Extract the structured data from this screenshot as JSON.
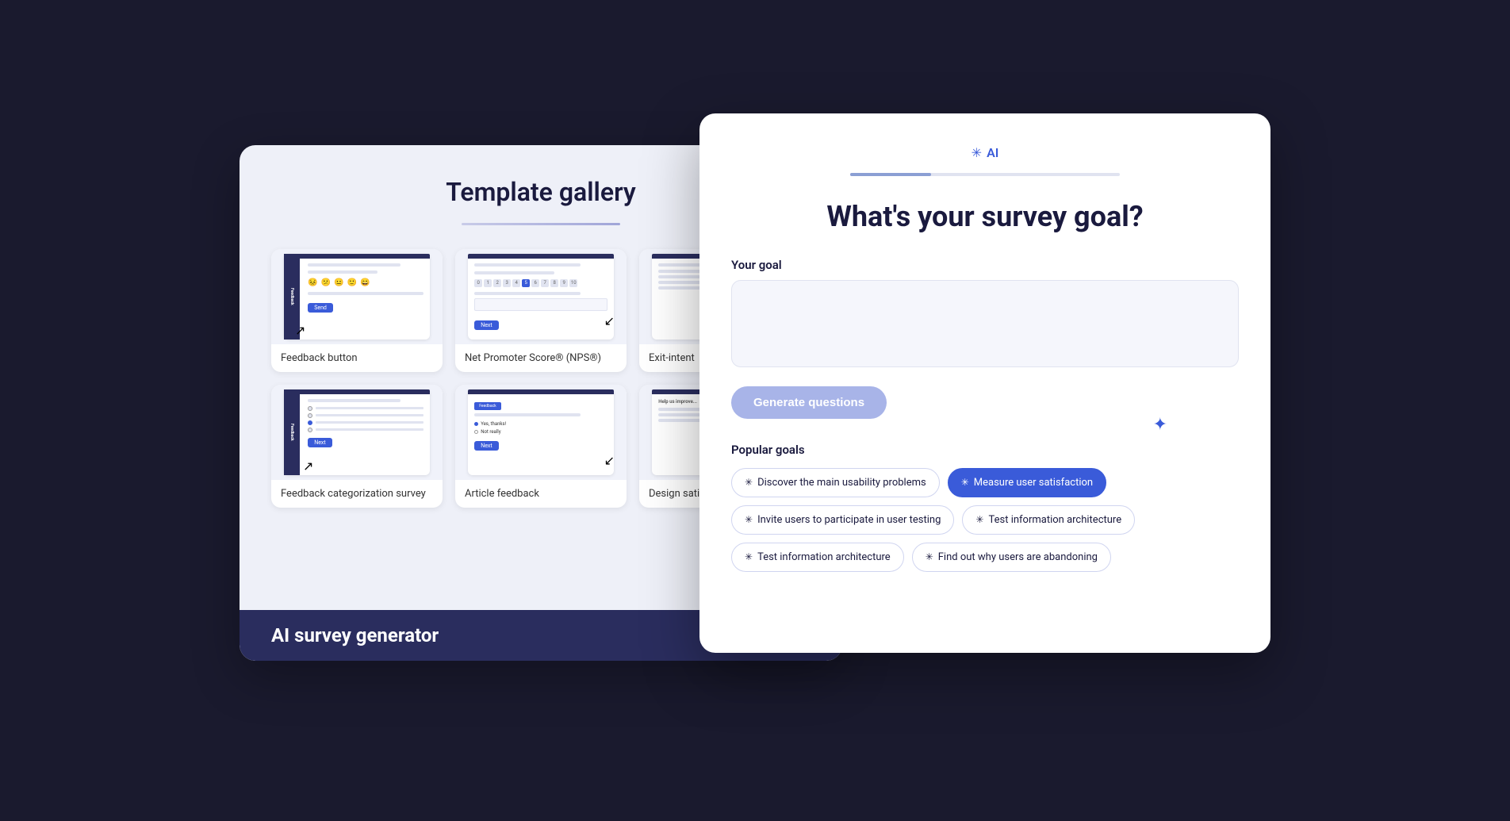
{
  "scene": {
    "background_color": "#1a1a2e"
  },
  "template_gallery": {
    "title": "Template gallery",
    "templates": [
      {
        "id": "feedback-button",
        "label": "Feedback button"
      },
      {
        "id": "nps",
        "label": "Net Promoter Score® (NPS®)"
      },
      {
        "id": "exit-intent",
        "label": "Exit-intent"
      },
      {
        "id": "feedback-categorization",
        "label": "Feedback categorization survey"
      },
      {
        "id": "article-feedback",
        "label": "Article feedback"
      },
      {
        "id": "design-satisfaction",
        "label": "Design satis..."
      }
    ],
    "ai_banner_label": "AI survey generator"
  },
  "ai_survey_goal": {
    "ai_icon": "✳",
    "ai_label": "AI",
    "progress_percent": 30,
    "main_title": "What's your survey goal?",
    "goal_section_label": "Your goal",
    "goal_placeholder": "",
    "generate_button_label": "Generate questions",
    "popular_goals_label": "Popular goals",
    "goals": [
      {
        "id": "usability",
        "label": "Discover the main usability problems",
        "active": false
      },
      {
        "id": "measure-satisfaction",
        "label": "Measure user satisfaction",
        "active": true
      },
      {
        "id": "invite-users",
        "label": "Invite users to participate in user testing",
        "active": false
      },
      {
        "id": "test-ia-1",
        "label": "Test information architecture",
        "active": false
      },
      {
        "id": "test-ia-2",
        "label": "Test information architecture",
        "active": false
      },
      {
        "id": "abandoning",
        "label": "Find out why users are abandoning",
        "active": false
      }
    ],
    "sparkle_decoration": "✦"
  }
}
